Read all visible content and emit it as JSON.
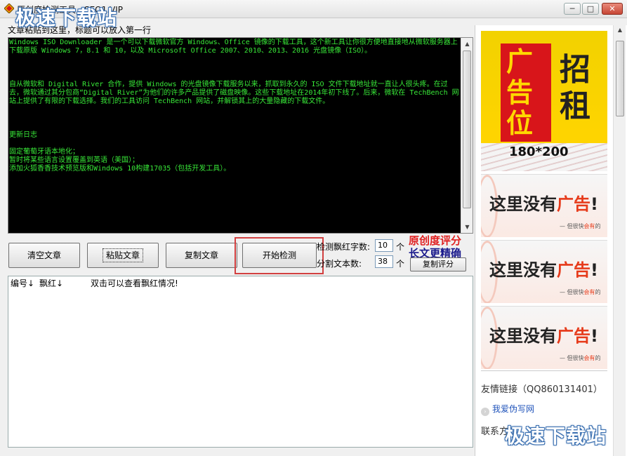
{
  "window": {
    "title": "原创度检测工具 - SEO1.VIP",
    "minimize": "─",
    "maximize": "□",
    "close": "✕"
  },
  "hint": "文章粘贴到这里，标题可以放入第一行",
  "console": {
    "text": "Windows ISO Downloader 是一个可以下载微软官方 Windows、Office 镜像的下载工具，这个新工具让你很方便地直接地从微软服务器上下载原版 Windows 7，8.1 和 10，以及 Microsoft Office 2007、2010、2013、2016 光盘镜像（ISO）。\n\n\n\n自从微软和 Digital River 合作，提供 Windows 的光盘镜像下载服务以来，抓取到永久的 ISO 文件下载地址就一直让人很头疼。在过去，微软通过其分包商“Digital River”为他们的许多产品提供了磁盘映像。这些下载地址在2014年初下线了。后来，微软在 TechBench 网站上提供了有限的下载选择。我们的工具访问 TechBench 网站，并解锁其上的大量隐藏的下载文件。\n\n\n\n更新日志\n\n固定葡萄牙语本地化；\n暂时将某些语言设置覆盖到英语（美国）；\n添加火狐香香技术预览版和Windows 10构建17035（包括开发工具）。"
  },
  "buttons": {
    "clear": "清空文章",
    "paste": "粘贴文章",
    "copy": "复制文章",
    "start": "开始检测",
    "copy_score": "复制评分"
  },
  "settings": {
    "red_label": "检测飘红字数:",
    "red_value": "10",
    "red_unit": "个",
    "split_label": "分割文本数:",
    "split_value": "38",
    "split_unit": "个"
  },
  "promo": {
    "line1": "原创度评分",
    "line2": "长文更精确"
  },
  "results": {
    "col_id": "编号↓",
    "col_red": "飘红↓",
    "hint": "双击可以查看飘红情况!"
  },
  "ads": {
    "main_char1": "广\n告\n位",
    "main_char2": "招\n租",
    "main_size": "180*200",
    "small_prefix": "这里没有",
    "small_red": "广告",
    "small_suffix": "!",
    "small_sub_prefix": "— 但很快",
    "small_sub_red": "会有",
    "small_sub_suffix": "的"
  },
  "links": {
    "title": "友情链接（QQ860131401）",
    "item1": "我爱伪写网",
    "contact": "联系方式"
  },
  "watermark": "极速下载站",
  "colors": {
    "console_bg": "#000000",
    "console_text": "#38e838",
    "highlight": "#d24040",
    "promo_red": "#e02020",
    "promo_blue": "#1a1a8c"
  }
}
